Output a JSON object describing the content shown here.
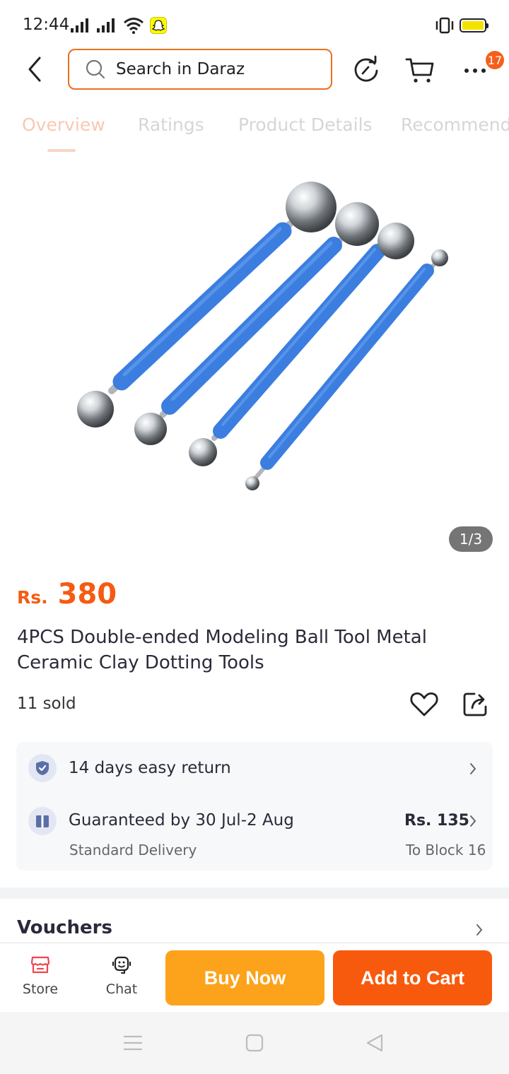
{
  "status_bar": {
    "time": "12:44",
    "icons": [
      "signal-icon",
      "signal-icon",
      "wifi-icon",
      "snapchat-icon",
      "vibrate-icon",
      "battery-icon"
    ]
  },
  "header": {
    "search_placeholder": "Search in Daraz",
    "cart_badge": "17",
    "icons": [
      "back-arrow-icon",
      "search-icon",
      "share-refresh-icon",
      "cart-icon",
      "more-icon"
    ]
  },
  "tabs": [
    {
      "label": "Overview",
      "active": true
    },
    {
      "label": "Ratings",
      "active": false
    },
    {
      "label": "Product Details",
      "active": false
    },
    {
      "label": "Recommended",
      "active": false
    }
  ],
  "gallery": {
    "pager": "1/3",
    "tool_color": "#3b7ee0"
  },
  "product": {
    "currency": "Rs.",
    "price": "380",
    "title": "4PCS Double-ended Modeling Ball Tool Metal Ceramic Clay Dotting Tools",
    "sold": "11 sold"
  },
  "services": {
    "return_text": "14 days easy return",
    "delivery_text": "Guaranteed by 30 Jul-2 Aug",
    "delivery_sub": "Standard Delivery",
    "shipping_price": "Rs. 135",
    "shipping_to": "To Block 16"
  },
  "vouchers": {
    "title": "Vouchers"
  },
  "bottom_bar": {
    "store_label": "Store",
    "chat_label": "Chat",
    "buy_now_label": "Buy Now",
    "add_to_cart_label": "Add to Cart"
  },
  "colors": {
    "accent": "#f55b11",
    "buy_now": "#fda31b",
    "add_to_cart": "#f85a0d"
  }
}
